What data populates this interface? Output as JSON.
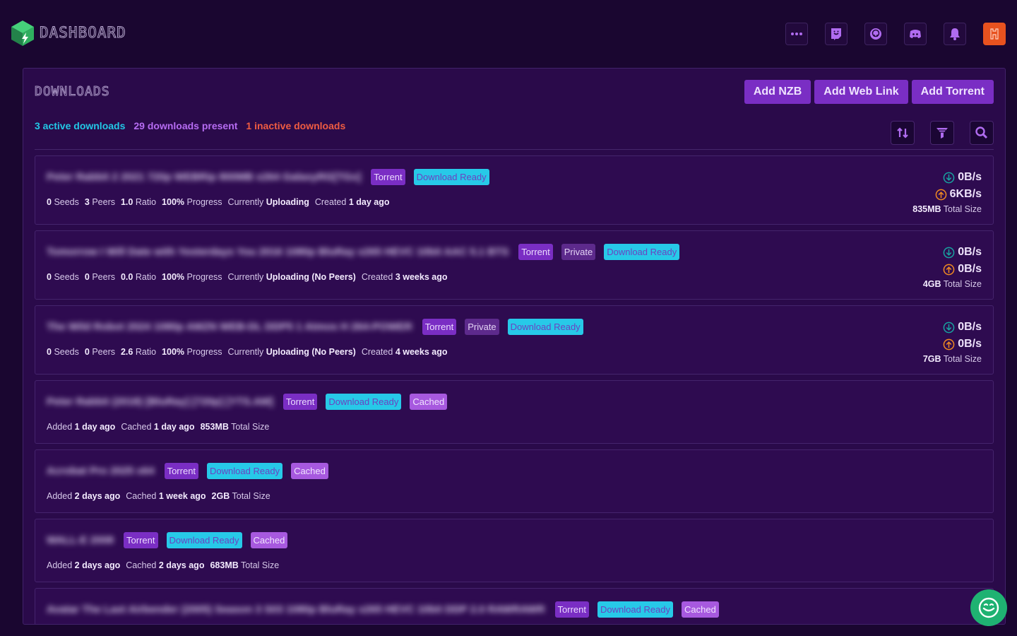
{
  "header": {
    "brand": "DASHBOARD",
    "icons": [
      "more-icon",
      "twitch-icon",
      "headset-icon",
      "discord-icon",
      "bell-icon",
      "avatar"
    ],
    "avatar_color": "#e8521f"
  },
  "downloads": {
    "title": "DOWNLOADS",
    "buttons": {
      "add_nzb": "Add NZB",
      "add_web_link": "Add Web Link",
      "add_torrent": "Add Torrent"
    },
    "stats": {
      "active": "3 active downloads",
      "present": "29 downloads present",
      "inactive": "1 inactive downloads"
    },
    "tools": [
      "sort-icon",
      "filter-icon",
      "search-icon"
    ],
    "items": [
      {
        "name": "Peter Rabbit 2 2021 720p WEBRip 800MB x264 GalaxyRG[TGx]",
        "badges": {
          "torrent": "Torrent",
          "private": "",
          "ready": "Download Ready",
          "cached": ""
        },
        "seeds": "0",
        "seeds_label": "Seeds",
        "peers": "3",
        "peers_label": "Peers",
        "ratio": "1.0",
        "ratio_label": "Ratio",
        "progress": "100%",
        "progress_label": "Progress",
        "currently_label": "Currently",
        "state": "Uploading",
        "created_label": "Created",
        "created": "1 day ago",
        "down_speed": "0B/s",
        "up_speed": "6KB/s",
        "size": "835MB",
        "size_label": "Total Size"
      },
      {
        "name": "Tomorrow I Will Date with Yesterdays You 2016 1080p BluRay x265 HEVC 10bit AAC 5.1 BTS",
        "badges": {
          "torrent": "Torrent",
          "private": "Private",
          "ready": "Download Ready",
          "cached": ""
        },
        "seeds": "0",
        "seeds_label": "Seeds",
        "peers": "0",
        "peers_label": "Peers",
        "ratio": "0.0",
        "ratio_label": "Ratio",
        "progress": "100%",
        "progress_label": "Progress",
        "currently_label": "Currently",
        "state": "Uploading (No Peers)",
        "created_label": "Created",
        "created": "3 weeks ago",
        "down_speed": "0B/s",
        "up_speed": "0B/s",
        "size": "4GB",
        "size_label": "Total Size"
      },
      {
        "name": "The Wild Robot 2024 1080p AMZN WEB-DL DDP5 1 Atmos H 264-POWER",
        "badges": {
          "torrent": "Torrent",
          "private": "Private",
          "ready": "Download Ready",
          "cached": ""
        },
        "seeds": "0",
        "seeds_label": "Seeds",
        "peers": "0",
        "peers_label": "Peers",
        "ratio": "2.6",
        "ratio_label": "Ratio",
        "progress": "100%",
        "progress_label": "Progress",
        "currently_label": "Currently",
        "state": "Uploading (No Peers)",
        "created_label": "Created",
        "created": "4 weeks ago",
        "down_speed": "0B/s",
        "up_speed": "0B/s",
        "size": "7GB",
        "size_label": "Total Size"
      },
      {
        "name": "Peter Rabbit (2018) [BluRay] [720p] [YTS.AM]",
        "badges": {
          "torrent": "Torrent",
          "private": "",
          "ready": "Download Ready",
          "cached": "Cached"
        },
        "added_label": "Added",
        "added": "1 day ago",
        "cached_label": "Cached",
        "cached": "1 day ago",
        "size": "853MB",
        "size_label": "Total Size"
      },
      {
        "name": "Acrobat Pro 2025 x64",
        "badges": {
          "torrent": "Torrent",
          "private": "",
          "ready": "Download Ready",
          "cached": "Cached"
        },
        "added_label": "Added",
        "added": "2 days ago",
        "cached_label": "Cached",
        "cached": "1 week ago",
        "size": "2GB",
        "size_label": "Total Size"
      },
      {
        "name": "WALL-E 2008",
        "badges": {
          "torrent": "Torrent",
          "private": "",
          "ready": "Download Ready",
          "cached": "Cached"
        },
        "added_label": "Added",
        "added": "2 days ago",
        "cached_label": "Cached",
        "cached": "2 days ago",
        "size": "683MB",
        "size_label": "Total Size"
      },
      {
        "name": "Avatar The Last Airbender (2005) Season 3 S03 1080p BluRay x265 HEVC 10bit DDP 2.0 RAWRAWR",
        "badges": {
          "torrent": "Torrent",
          "private": "",
          "ready": "Download Ready",
          "cached": "Cached"
        }
      }
    ]
  },
  "chat": {
    "icon": "chat-smile-icon"
  },
  "colors": {
    "background": "#1a0630",
    "panel": "#2a0a4a",
    "accent": "#7a2ec4",
    "cyan": "#27c9e8",
    "red": "#ef5c42"
  }
}
